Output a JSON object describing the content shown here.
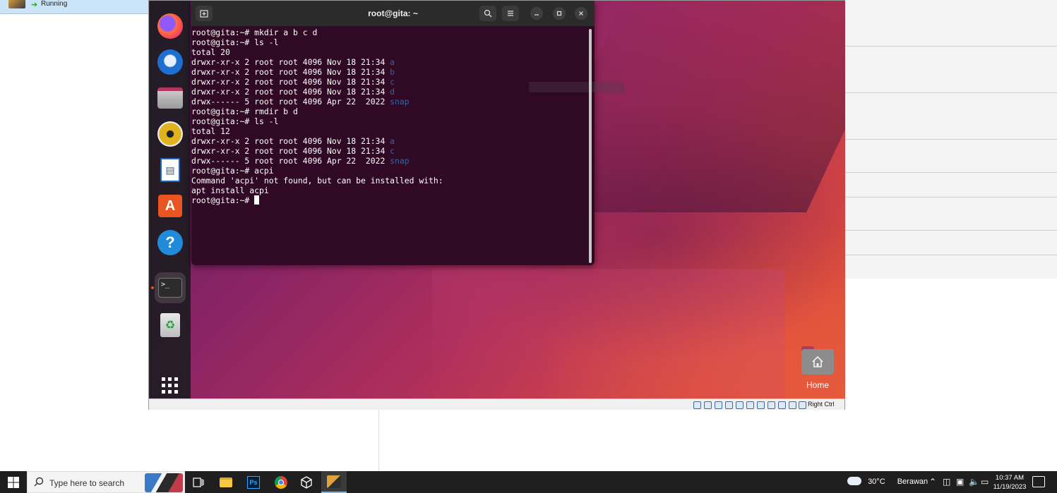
{
  "host": {
    "vm_status": "Running"
  },
  "vm": {
    "terminal": {
      "title": "root@gita: ~",
      "lines": [
        [
          {
            "t": "root@gita:~# mkdir a b c d"
          }
        ],
        [
          {
            "t": "root@gita:~# ls -l"
          }
        ],
        [
          {
            "t": "total 20"
          }
        ],
        [
          {
            "t": "drwxr-xr-x 2 root root 4096 Nov 18 21:34 "
          },
          {
            "t": "a",
            "c": "blue"
          }
        ],
        [
          {
            "t": "drwxr-xr-x 2 root root 4096 Nov 18 21:34 "
          },
          {
            "t": "b",
            "c": "blue"
          }
        ],
        [
          {
            "t": "drwxr-xr-x 2 root root 4096 Nov 18 21:34 "
          },
          {
            "t": "c",
            "c": "blue"
          }
        ],
        [
          {
            "t": "drwxr-xr-x 2 root root 4096 Nov 18 21:34 "
          },
          {
            "t": "d",
            "c": "blue"
          }
        ],
        [
          {
            "t": "drwx------ 5 root root 4096 Apr 22  2022 "
          },
          {
            "t": "snap",
            "c": "blue"
          }
        ],
        [
          {
            "t": "root@gita:~# rmdir b d"
          }
        ],
        [
          {
            "t": "root@gita:~# ls -l"
          }
        ],
        [
          {
            "t": "total 12"
          }
        ],
        [
          {
            "t": "drwxr-xr-x 2 root root 4096 Nov 18 21:34 "
          },
          {
            "t": "a",
            "c": "blue"
          }
        ],
        [
          {
            "t": "drwxr-xr-x 2 root root 4096 Nov 18 21:34 "
          },
          {
            "t": "c",
            "c": "blue"
          }
        ],
        [
          {
            "t": "drwx------ 5 root root 4096 Apr 22  2022 "
          },
          {
            "t": "snap",
            "c": "blue"
          }
        ],
        [
          {
            "t": "root@gita:~# acpi"
          }
        ],
        [
          {
            "t": "Command 'acpi' not found, but can be installed with:"
          }
        ],
        [
          {
            "t": "apt install acpi"
          }
        ],
        [
          {
            "t": "root@gita:~# "
          }
        ]
      ]
    },
    "desktop": {
      "home_label": "Home"
    },
    "statusbar": {
      "host_key": "Right Ctrl"
    }
  },
  "taskbar": {
    "search_placeholder": "Type here to search",
    "weather": {
      "temp": "30°C",
      "desc": "Berawan"
    },
    "clock": {
      "time": "10:37 AM",
      "date": "11/19/2023"
    }
  },
  "colors": {
    "terminal_bg": "#300a24",
    "ls_dir": "#3465a4",
    "ubuntu_orange": "#e95420"
  }
}
